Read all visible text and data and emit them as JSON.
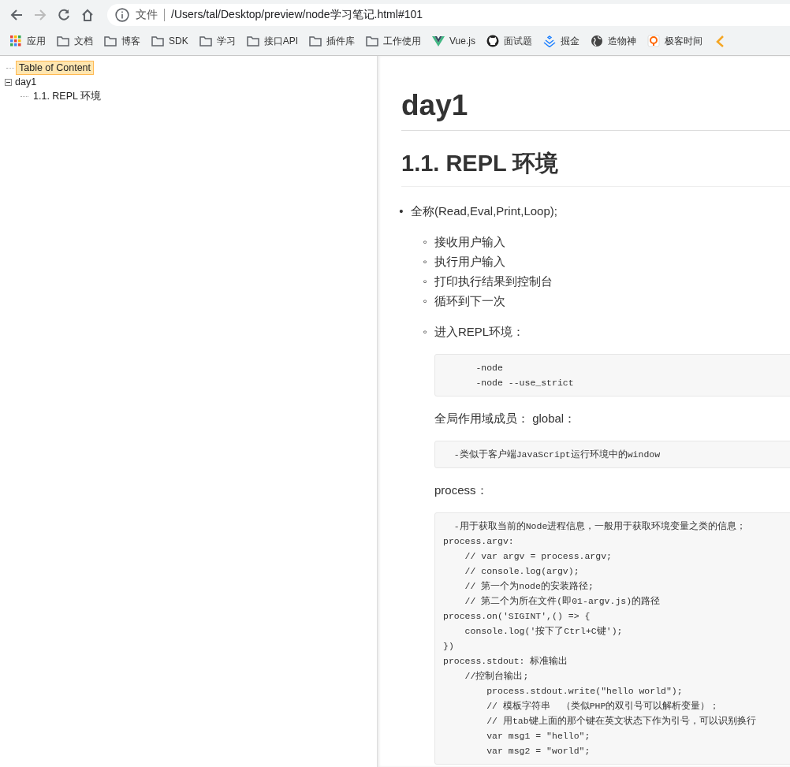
{
  "toolbar": {
    "buttons": [
      {
        "kind": "back",
        "disabled": false
      },
      {
        "kind": "forward",
        "disabled": true
      },
      {
        "kind": "reload",
        "disabled": false
      },
      {
        "kind": "home",
        "disabled": false
      }
    ],
    "address": {
      "scheme": "文件",
      "url": "/Users/tal/Desktop/preview/node学习笔记.html#101"
    }
  },
  "bookmarks": [
    {
      "kind": "apps",
      "label": "应用"
    },
    {
      "kind": "folder",
      "label": "文档"
    },
    {
      "kind": "folder",
      "label": "博客"
    },
    {
      "kind": "folder",
      "label": "SDK"
    },
    {
      "kind": "folder",
      "label": "学习"
    },
    {
      "kind": "folder",
      "label": "接口API"
    },
    {
      "kind": "folder",
      "label": "插件库"
    },
    {
      "kind": "folder",
      "label": "工作使用"
    },
    {
      "kind": "vue",
      "label": "Vue.js"
    },
    {
      "kind": "github",
      "label": "面试题"
    },
    {
      "kind": "juejin",
      "label": "掘金"
    },
    {
      "kind": "globe",
      "label": "造物神"
    },
    {
      "kind": "geek",
      "label": "极客时间"
    },
    {
      "kind": "partial"
    }
  ],
  "toc": {
    "root": {
      "label": "Table of Content",
      "selected": true
    },
    "items": [
      {
        "label": "day1",
        "selected": false,
        "expanded": true,
        "children": [
          {
            "label": "1.1. REPL 环境",
            "selected": false
          }
        ]
      }
    ]
  },
  "document": {
    "blocks": [
      {
        "kind": "h1",
        "text": "day1"
      },
      {
        "kind": "h2",
        "text": "1.1. REPL 环境"
      },
      {
        "kind": "list",
        "items": [
          {
            "marker": "•",
            "text": "全称(Read,Eval,Print,Loop);",
            "children": [
              {
                "marker": "◦",
                "text": "接收用户输入"
              },
              {
                "marker": "◦",
                "text": "执行用户输入"
              },
              {
                "marker": "◦",
                "text": "打印执行结果到控制台"
              },
              {
                "marker": "◦",
                "text": "循环到下一次"
              },
              {
                "marker": "◦",
                "text": "进入REPL环境：",
                "blocks": [
                  {
                    "kind": "code",
                    "lines": [
                      "      -node",
                      "      -node --use_strict"
                    ]
                  },
                  {
                    "kind": "para",
                    "text": "全局作用域成员： global："
                  },
                  {
                    "kind": "code",
                    "lines": [
                      "  -类似于客户端JavaScript运行环境中的window"
                    ]
                  },
                  {
                    "kind": "para",
                    "text": "process："
                  },
                  {
                    "kind": "code",
                    "lines": [
                      "  -用于获取当前的Node进程信息，一般用于获取环境变量之类的信息；",
                      "process.argv:",
                      "    // var argv = process.argv;",
                      "    // console.log(argv);",
                      "    // 第一个为node的安装路径;",
                      "    // 第二个为所在文件(即01-argv.js)的路径",
                      "process.on('SIGINT',() => {",
                      "    console.log('按下了Ctrl+C键');",
                      "})",
                      "process.stdout: 标准输出",
                      "    //控制台输出;",
                      "        process.stdout.write(\"hello world\");",
                      "        // 模板字符串  （类似PHP的双引号可以解析变量）；",
                      "        // 用tab键上面的那个键在英文状态下作为引号，可以识别换行",
                      "        var msg1 = \"hello\";",
                      "        var msg2 = \"world\";"
                    ]
                  }
                ]
              }
            ]
          }
        ]
      }
    ]
  }
}
